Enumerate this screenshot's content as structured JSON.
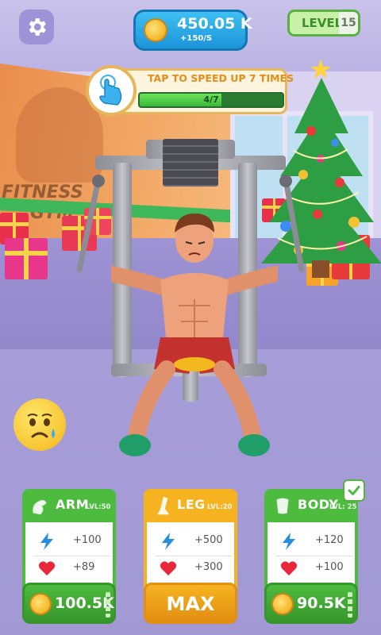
{
  "hud": {
    "coins": "450.05 K",
    "coins_rate": "+150/S",
    "level_label": "LEVEL",
    "level_value": "15"
  },
  "tap_prompt": {
    "text": "TAP TO SPEED UP 7 TIMES",
    "progress_text": "4/7",
    "progress": 0.571
  },
  "scene": {
    "wall_sign": [
      "FITNESS",
      "GYM"
    ]
  },
  "cards": [
    {
      "id": "arm",
      "title": "ARM",
      "level": "LVL:50",
      "power": "+100",
      "health": "+89",
      "price": "100.5K",
      "max": false,
      "theme": "green"
    },
    {
      "id": "leg",
      "title": "LEG",
      "level": "LVL:20",
      "power": "+500",
      "health": "+300",
      "price": "MAX",
      "max": true,
      "theme": "orange"
    },
    {
      "id": "body",
      "title": "BODY",
      "level": "LVL: 25",
      "power": "+120",
      "health": "+100",
      "price": "90.5K",
      "max": false,
      "theme": "green"
    }
  ],
  "colors": {
    "green": "#4cbb3e",
    "green_dark": "#37962b",
    "orange": "#f6b31f",
    "orange_dark": "#e28e12",
    "power_icon": "#2a8ee0",
    "health_icon": "#e8283a"
  },
  "icons": {
    "settings": "gear-icon",
    "coin": "coin-icon",
    "tap": "tap-hand-icon",
    "power": "lightning-icon",
    "health": "heart-icon",
    "emotion": "sad-face-icon",
    "check": "check-icon"
  }
}
